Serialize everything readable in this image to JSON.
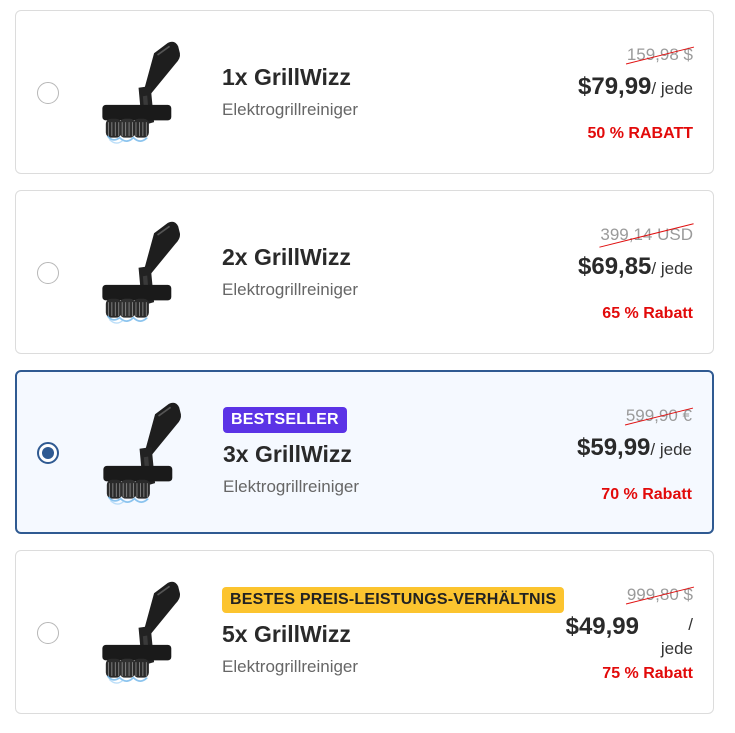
{
  "offers": [
    {
      "qty_label": "1x GrillWizz",
      "subtitle": "Elektrogrillreiniger",
      "old_price": "159,98 $",
      "price": "$79,99",
      "unit": "/ jede",
      "discount": "50 % RABATT",
      "badge": null,
      "selected": false
    },
    {
      "qty_label": "2x GrillWizz",
      "subtitle": "Elektrogrillreiniger",
      "old_price": "399,14 USD",
      "price": "$69,85",
      "unit": "/ jede",
      "discount": "65 % Rabatt",
      "badge": null,
      "selected": false
    },
    {
      "qty_label": "3x GrillWizz",
      "subtitle": "Elektrogrillreiniger",
      "old_price": "599,90 €",
      "price": "$59,99",
      "unit": "/ jede",
      "discount": "70 % Rabatt",
      "badge": "BESTSELLER",
      "selected": true
    },
    {
      "qty_label": "5x GrillWizz",
      "subtitle": "Elektrogrillreiniger",
      "old_price": "999,80 $",
      "price": "$49,99",
      "unit": "/ jede",
      "discount": "75 % Rabatt",
      "badge": "BESTES PREIS-LEISTUNGS-VERHÄLTNIS",
      "selected": false
    }
  ],
  "icon": "grill-cleaner-product-image",
  "colors": {
    "accent": "#2f5a92",
    "discount": "#e20a0a",
    "badge_bestseller": "#5b33e6",
    "badge_value": "#fcc42f"
  }
}
